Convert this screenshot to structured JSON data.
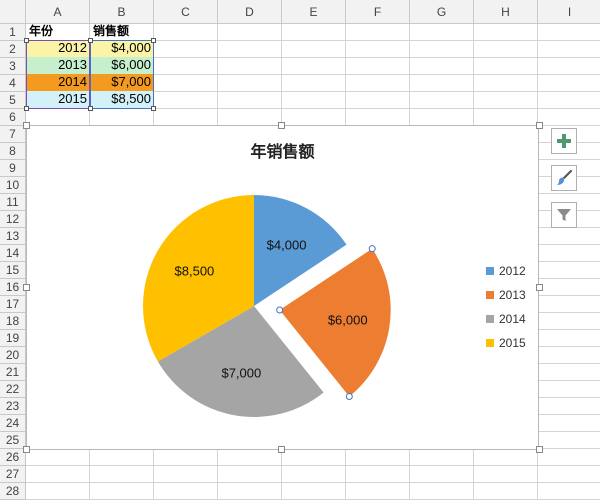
{
  "columns": [
    "A",
    "B",
    "C",
    "D",
    "E",
    "F",
    "G",
    "H",
    "I"
  ],
  "rows": [
    "1",
    "2",
    "3",
    "4",
    "5",
    "6",
    "7",
    "8",
    "9",
    "10",
    "11",
    "12",
    "13",
    "14",
    "15",
    "16",
    "17",
    "18",
    "19",
    "20",
    "21",
    "22",
    "23",
    "24",
    "25",
    "26",
    "27",
    "28"
  ],
  "table": {
    "headers": [
      "年份",
      "销售额"
    ],
    "data": [
      {
        "year": "2012",
        "sales": "$4,000",
        "color": "#fbf3a6"
      },
      {
        "year": "2013",
        "sales": "$6,000",
        "color": "#c6efce"
      },
      {
        "year": "2014",
        "sales": "$7,000",
        "color": "#f49a1f"
      },
      {
        "year": "2015",
        "sales": "$8,500",
        "color": "#d3f1f8"
      }
    ]
  },
  "chart_data": {
    "type": "pie",
    "title": "年销售额",
    "categories": [
      "2012",
      "2013",
      "2014",
      "2015"
    ],
    "values": [
      4000,
      6000,
      7000,
      8500
    ],
    "data_labels": [
      "$4,000",
      "$6,000",
      "$7,000",
      "$8,500"
    ],
    "colors": [
      "#5b9bd5",
      "#ed7d31",
      "#a5a5a5",
      "#ffc000"
    ],
    "exploded": "2013",
    "legend_position": "right"
  },
  "chart_buttons": [
    {
      "name": "add-chart-element-button",
      "icon": "plus-icon"
    },
    {
      "name": "chart-styles-button",
      "icon": "paintbrush-icon"
    },
    {
      "name": "chart-filters-button",
      "icon": "funnel-icon"
    }
  ]
}
